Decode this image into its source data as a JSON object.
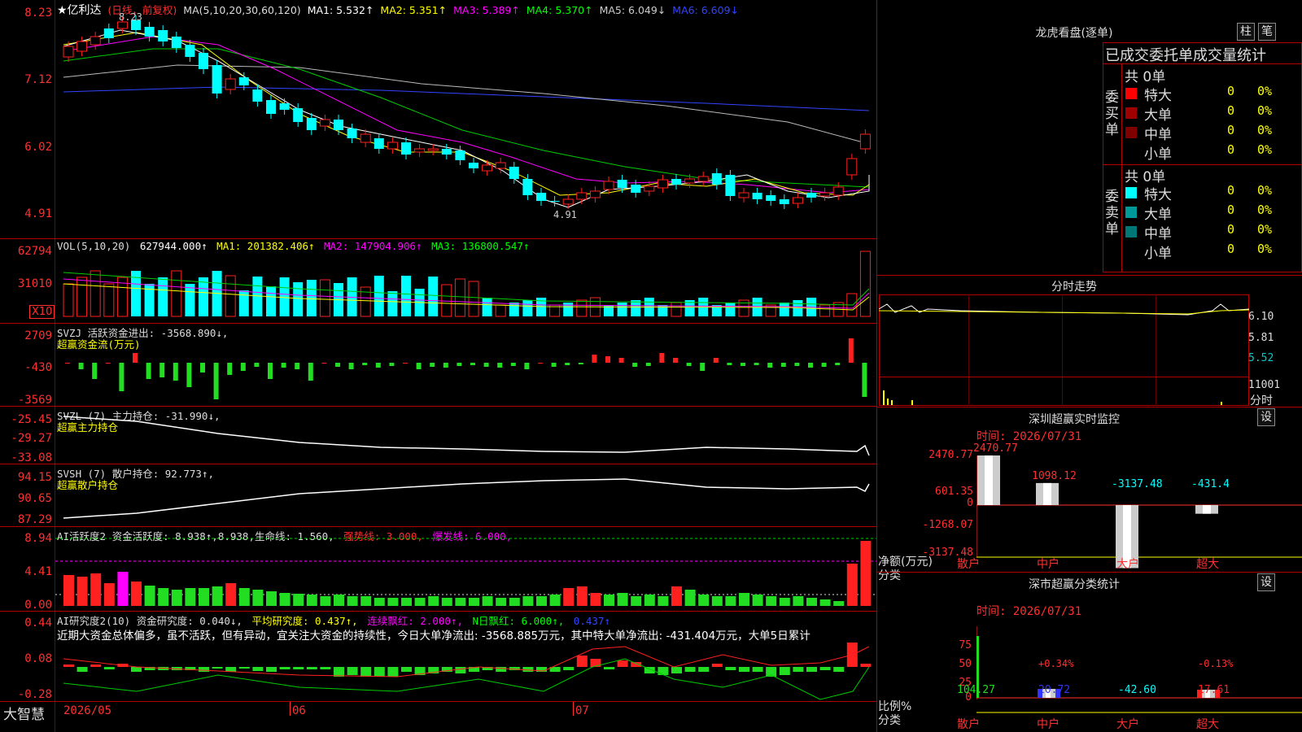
{
  "stock": {
    "name": "★亿利达",
    "period": "(日线，前复权)"
  },
  "ma_line": {
    "label": "MA(5,10,20,30,60,120)",
    "ma1": "MA1: 5.532↑",
    "ma2": "MA2: 5.351↑",
    "ma3": "MA3: 5.389↑",
    "ma4": "MA4: 5.370↑",
    "ma5": "MA5: 6.049↓",
    "ma6": "MA6: 6.609↓"
  },
  "price_axis": [
    "8.23",
    "7.12",
    "6.02",
    "4.91"
  ],
  "price_marks": {
    "high": "8.23",
    "low": "4.91"
  },
  "vol": {
    "label": "VOL(5,10,20)",
    "value": "627944.000↑",
    "ma1": "MA1: 201382.406↑",
    "ma2": "MA2: 147904.906↑",
    "ma3": "MA3: 136800.547↑",
    "axis": [
      "62794",
      "31010"
    ],
    "unit": "X10"
  },
  "svzj": {
    "label": "SVZJ  活跃资金进出: -3568.890↓,",
    "sub": "超赢资金流(万元)",
    "axis": [
      "2709",
      "-430",
      "-3569"
    ]
  },
  "svzl": {
    "label": "SVZL (7) 主力持仓: -31.990↓,",
    "sub": "超赢主力持仓",
    "axis": [
      "-25.45",
      "-29.27",
      "-33.08"
    ]
  },
  "svsh": {
    "label": "SVSH (7) 散户持仓: 92.773↑,",
    "sub": "超赢散户持仓",
    "axis": [
      "94.15",
      "90.65",
      "87.29"
    ]
  },
  "ai1": {
    "label": "AI活跃度2 资金活跃度: 8.938↑,8.938,生命线: 1.560,",
    "strong": "强势线: 3.000,",
    "burst": "爆发线: 6.000,",
    "axis": [
      "8.94",
      "4.41",
      "0.00"
    ]
  },
  "ai2": {
    "label": "AI研究度2(10) 资金研究度: 0.040↓,",
    "avg": "平均研究度: 0.437↑,",
    "red": "连续飘红: 2.000↑,",
    "nred": "N日飘红: 6.000↑,",
    "last": "0.437↑",
    "axis": [
      "0.44",
      "0.08",
      "-0.28"
    ],
    "comment": "近期大资金总体偏多，虽不活跃，但有异动，宜关注大资金的持续性，今日大单净流出: -3568.885万元，其中特大单净流出: -431.404万元，大单5日累计"
  },
  "bottom": {
    "brand": "大智慧",
    "dates": [
      "2026/05",
      "06",
      "07"
    ]
  },
  "dragon": {
    "title": "龙虎看盘(逐单)",
    "btn1": "柱",
    "btn2": "笔",
    "header": "已成交委托单成交量统计",
    "buy_total": "共 0单",
    "buy_side": "委买单",
    "sell_total": "共 0单",
    "sell_side": "委卖单",
    "buy_rows": [
      {
        "name": "特大",
        "v": "0",
        "p": "0%",
        "c": "#ff0000"
      },
      {
        "name": "大单",
        "v": "0",
        "p": "0%",
        "c": "#a00000"
      },
      {
        "name": "中单",
        "v": "0",
        "p": "0%",
        "c": "#800000"
      },
      {
        "name": "小单",
        "v": "0",
        "p": "0%",
        "c": ""
      }
    ],
    "sell_rows": [
      {
        "name": "特大",
        "v": "0",
        "p": "0%",
        "c": "#00ffff"
      },
      {
        "name": "大单",
        "v": "0",
        "p": "0%",
        "c": "#009999"
      },
      {
        "name": "中单",
        "v": "0",
        "p": "0%",
        "c": "#007777"
      },
      {
        "name": "小单",
        "v": "0",
        "p": "0%",
        "c": ""
      }
    ]
  },
  "intraday": {
    "title": "分时走势",
    "axis": [
      "6.10",
      "5.81",
      "5.52",
      "11001"
    ],
    "unit": "分时"
  },
  "sz_monitor": {
    "title": "深圳超赢实时监控",
    "btn": "设",
    "time": "时间: 2026/07/31",
    "axis": [
      "2470.77",
      "601.35",
      "0",
      "-1268.07",
      "-3137.48"
    ],
    "unit": "净额(万元)",
    "cat_label": "分类",
    "bars": [
      {
        "cat": "散户",
        "value": "2470.77"
      },
      {
        "cat": "中户",
        "value": "1098.12"
      },
      {
        "cat": "大户",
        "value": "-3137.48"
      },
      {
        "cat": "超大",
        "value": "-431.4"
      }
    ]
  },
  "sz_class": {
    "title": "深市超赢分类统计",
    "btn": "设",
    "time": "时间: 2026/07/31",
    "axis": [
      "75",
      "50",
      "25",
      "0"
    ],
    "unit": "比例%",
    "cat_label": "分类",
    "bars": [
      {
        "cat": "散户",
        "value": "104.27",
        "pct": ""
      },
      {
        "cat": "中户",
        "value": "20.72",
        "pct": "+0.34%"
      },
      {
        "cat": "大户",
        "value": "-42.60",
        "pct": ""
      },
      {
        "cat": "超大",
        "value": "17.61",
        "pct": "-0.13%"
      }
    ]
  }
}
